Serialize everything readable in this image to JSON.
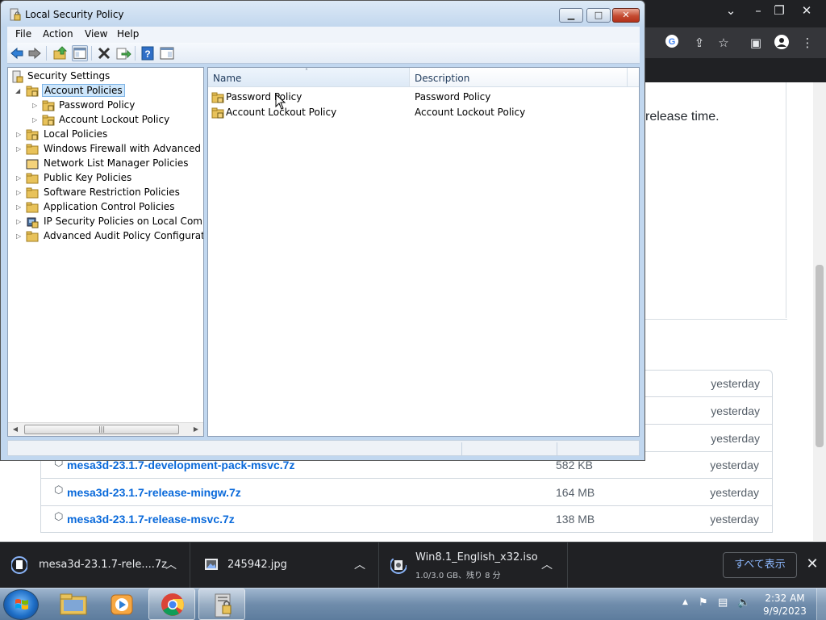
{
  "browser": {
    "content_text": "release time.",
    "files": [
      {
        "name": "",
        "size": "",
        "date": "yesterday"
      },
      {
        "name": "",
        "size": "",
        "date": "yesterday"
      },
      {
        "name": "",
        "size": "",
        "date": "yesterday"
      },
      {
        "name": "mesa3d-23.1.7-development-pack-msvc.7z",
        "size": "582 KB",
        "date": "yesterday"
      },
      {
        "name": "mesa3d-23.1.7-release-mingw.7z",
        "size": "164 MB",
        "date": "yesterday"
      },
      {
        "name": "mesa3d-23.1.7-release-msvc.7z",
        "size": "138 MB",
        "date": "yesterday"
      }
    ]
  },
  "downloads": {
    "items": [
      {
        "name": "mesa3d-23.1.7-rele....7z",
        "sub": ""
      },
      {
        "name": "245942.jpg",
        "sub": ""
      },
      {
        "name": "Win8.1_English_x32.iso",
        "sub": "1.0/3.0 GB、残り 8 分"
      }
    ],
    "show_all": "すべて表示"
  },
  "taskbar": {
    "time": "2:32 AM",
    "date": "9/9/2023"
  },
  "window": {
    "title": "Local Security Policy",
    "menu": [
      "File",
      "Action",
      "View",
      "Help"
    ]
  },
  "tree": {
    "root": "Security Settings",
    "items": [
      {
        "label": "Account Policies",
        "selected": true
      },
      {
        "label": "Password Policy"
      },
      {
        "label": "Account Lockout Policy"
      },
      {
        "label": "Local Policies"
      },
      {
        "label": "Windows Firewall with Advanced Security"
      },
      {
        "label": "Network List Manager Policies"
      },
      {
        "label": "Public Key Policies"
      },
      {
        "label": "Software Restriction Policies"
      },
      {
        "label": "Application Control Policies"
      },
      {
        "label": "IP Security Policies on Local Computer"
      },
      {
        "label": "Advanced Audit Policy Configuration"
      }
    ]
  },
  "list": {
    "columns": [
      "Name",
      "Description"
    ],
    "rows": [
      {
        "name": "Password Policy",
        "description": "Password Policy"
      },
      {
        "name": "Account Lockout Policy",
        "description": "Account Lockout Policy"
      }
    ]
  },
  "colors": {
    "title_bar": "#c2d7ee",
    "selection": "#cde6fb",
    "link": "#0969da",
    "chrome_dark": "#202124",
    "close_button": "#c54b31"
  }
}
